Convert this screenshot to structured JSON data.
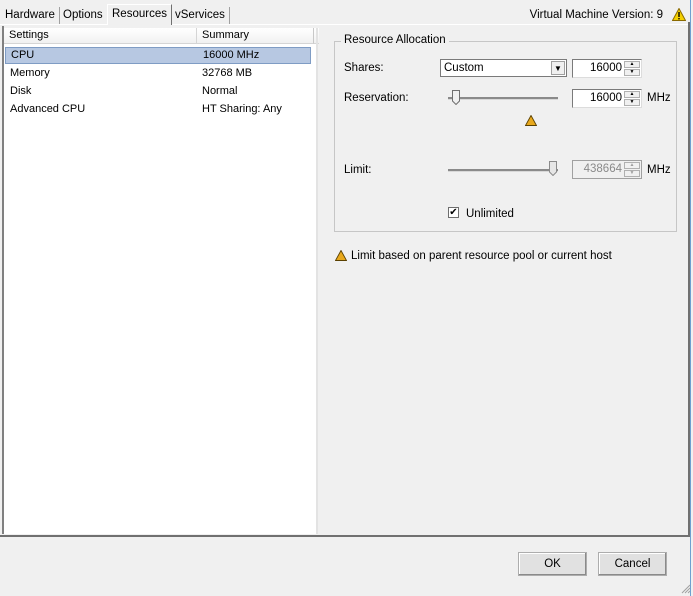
{
  "tabs": [
    {
      "label": "Hardware",
      "active": false
    },
    {
      "label": "Options",
      "active": false
    },
    {
      "label": "Resources",
      "active": true
    },
    {
      "label": "vServices",
      "active": false
    }
  ],
  "version": {
    "label": "Virtual Machine Version: 9",
    "icon": "warning-icon"
  },
  "settings_list": {
    "columns": [
      "Settings",
      "Summary"
    ],
    "rows": [
      {
        "setting": "CPU",
        "summary": "16000 MHz",
        "selected": true
      },
      {
        "setting": "Memory",
        "summary": "32768 MB",
        "selected": false
      },
      {
        "setting": "Disk",
        "summary": "Normal",
        "selected": false
      },
      {
        "setting": "Advanced CPU",
        "summary": "HT Sharing: Any",
        "selected": false
      }
    ]
  },
  "resource_allocation": {
    "title": "Resource Allocation",
    "shares": {
      "label": "Shares:",
      "selected": "Custom",
      "value": "16000"
    },
    "reservation": {
      "label": "Reservation:",
      "value": "16000",
      "unit": "MHz",
      "slider_fraction": 0.04,
      "warning_icon": "warning-icon"
    },
    "limit": {
      "label": "Limit:",
      "value": "438664",
      "unit": "MHz",
      "slider_fraction": 1.0,
      "disabled": true
    },
    "unlimited": {
      "label": "Unlimited",
      "checked": true,
      "check_glyph": "✔"
    }
  },
  "note": {
    "icon": "warning-icon",
    "text": "Limit based on parent resource pool or current host"
  },
  "buttons": {
    "ok": "OK",
    "cancel": "Cancel"
  },
  "glyphs": {
    "dropdown": "▼",
    "spin_up": "▲",
    "spin_down": "▼"
  }
}
